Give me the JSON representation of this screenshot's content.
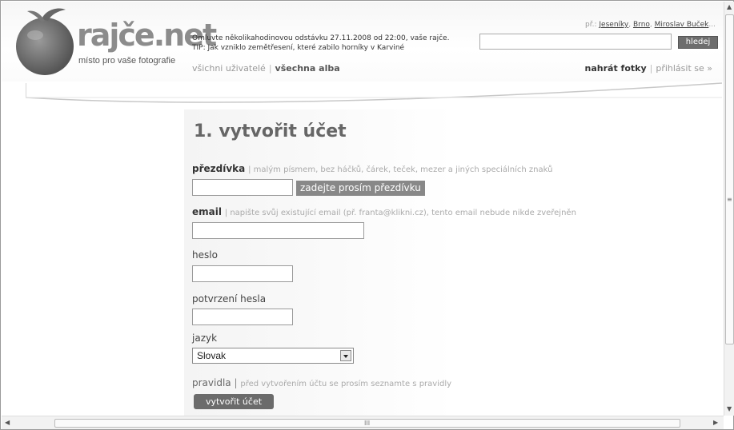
{
  "header": {
    "logo_text": "rajče.net",
    "tagline": "místo pro vaše fotografie",
    "notice_line1": "Omluvte několikahodinovou odstávku 27.11.2008 od 22:00, vaše rajče.",
    "notice_line2": "TIP: Jak vzniklo zemětřesení, které zabilo horníky v Karviné",
    "nav_all_users": "všichni uživatelé",
    "nav_sep": "|",
    "nav_all_albums": "všechna alba",
    "examples_prefix": "př.:",
    "example1": "Jeseníky",
    "example2": "Brno",
    "example3": "Miroslav Buček",
    "ellipsis": "...",
    "search_button": "hledej",
    "upload_link": "nahrát fotky",
    "login_link": "přihlásit se »"
  },
  "form": {
    "title": "1. vytvořit účet",
    "nickname_label": "přezdívka",
    "nickname_hint": "| malým písmem, bez háčků, čárek, teček, mezer a jiných speciálních znaků",
    "nickname_error": "zadejte prosím přezdívku",
    "email_label": "email",
    "email_hint": "| napište svůj existující email (př. franta@klikni.cz), tento email nebude nikde zveřejněn",
    "password_label": "heslo",
    "password_confirm_label": "potvrzení hesla",
    "language_label": "jazyk",
    "language_value": "Slovak",
    "rules_label": "pravidla",
    "rules_sep": "|",
    "rules_hint": "před vytvořením účtu se prosím seznamte s pravidly",
    "submit_label": "vytvořit účet"
  },
  "scrollbar": {
    "h_grip": "III",
    "v_grip": "≡"
  }
}
